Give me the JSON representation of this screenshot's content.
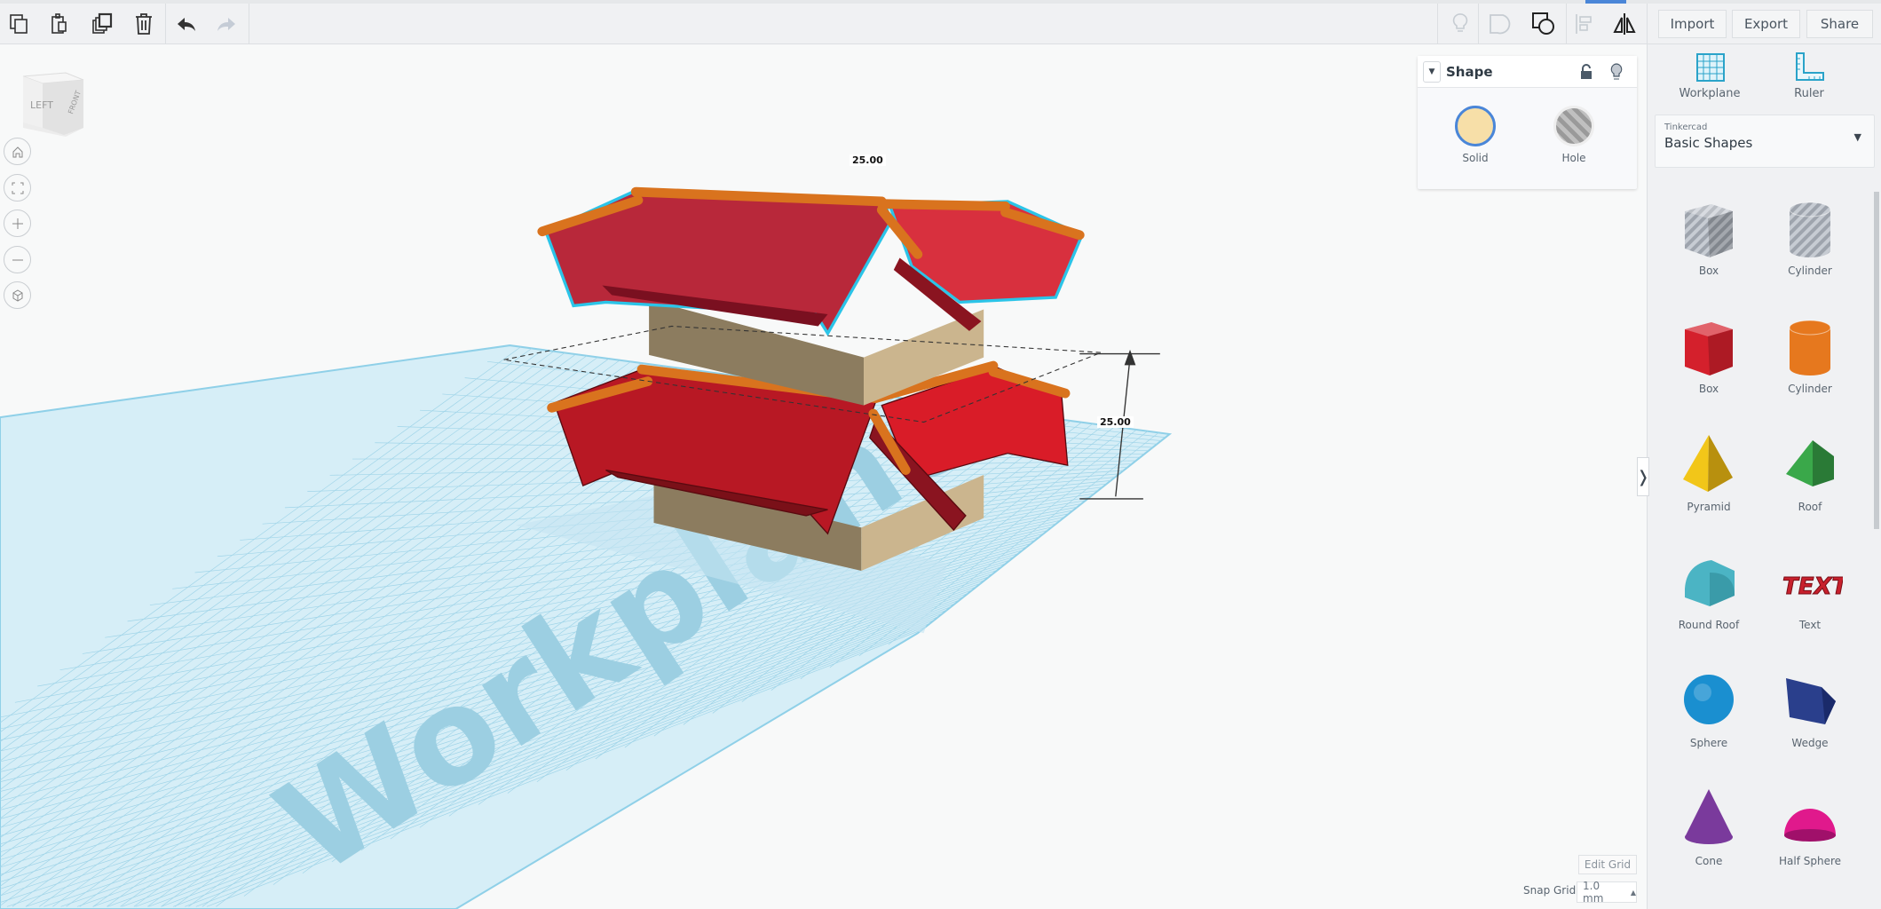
{
  "toolbar": {
    "left_icons": [
      "copy-icon",
      "paste-icon",
      "duplicate-icon",
      "delete-icon",
      "undo-icon",
      "redo-icon"
    ],
    "right_icons": [
      "show-all-icon",
      "hide-icon",
      "group-icon",
      "align-icon",
      "mirror-icon"
    ],
    "import": "Import",
    "export": "Export",
    "share": "Share"
  },
  "viewcube": {
    "left": "LEFT",
    "front": "FRONT"
  },
  "nav": [
    "home-icon",
    "fit-view-icon",
    "zoom-in-icon",
    "zoom-out-icon",
    "perspective-icon"
  ],
  "dimensions": {
    "width": "25.00",
    "height": "25.00"
  },
  "workplane_label": "Workplane",
  "shape_panel": {
    "title": "Shape",
    "solid": "Solid",
    "hole": "Hole",
    "solid_color": "#f7dfa8"
  },
  "tools": {
    "workplane": "Workplane",
    "ruler": "Ruler"
  },
  "library": {
    "source": "Tinkercad",
    "selected": "Basic Shapes"
  },
  "shapes": [
    {
      "label": "Box",
      "icon": "cube",
      "color": "#b9bec6",
      "striped": true
    },
    {
      "label": "Cylinder",
      "icon": "cylinder",
      "color": "#b9bec6",
      "striped": true
    },
    {
      "label": "Box",
      "icon": "cube",
      "color": "#d4202c"
    },
    {
      "label": "Cylinder",
      "icon": "cylinder",
      "color": "#e6781e"
    },
    {
      "label": "Pyramid",
      "icon": "pyramid",
      "color": "#f2c619"
    },
    {
      "label": "Roof",
      "icon": "roof",
      "color": "#3aa84a"
    },
    {
      "label": "Round Roof",
      "icon": "roundroof",
      "color": "#4bb4c4"
    },
    {
      "label": "Text",
      "icon": "text",
      "color": "#c8202c",
      "glyph": "TEXT"
    },
    {
      "label": "Sphere",
      "icon": "sphere",
      "color": "#1a8fd0"
    },
    {
      "label": "Wedge",
      "icon": "wedge",
      "color": "#2a3f8c"
    },
    {
      "label": "Cone",
      "icon": "cone",
      "color": "#7a3a9c"
    },
    {
      "label": "Half Sphere",
      "icon": "halfsphere",
      "color": "#e0198c"
    }
  ],
  "grid": {
    "edit": "Edit Grid",
    "snap_label": "Snap Grid",
    "snap_value": "1.0 mm"
  }
}
